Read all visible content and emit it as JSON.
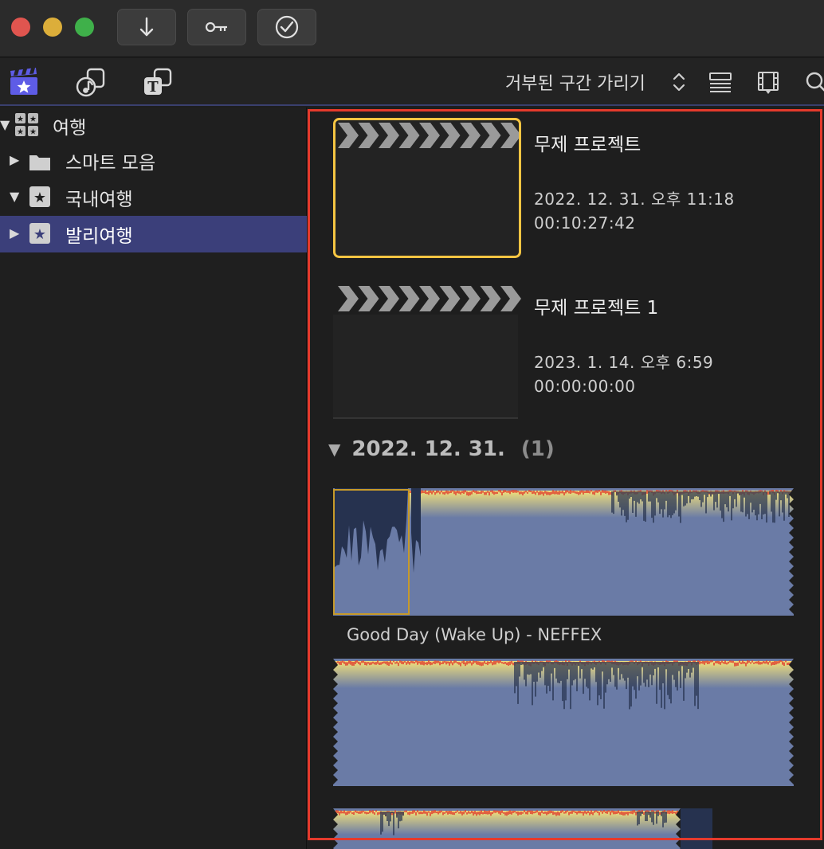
{
  "window": {
    "toolbar_buttons": [
      {
        "name": "import-button",
        "icon": "arrow-down-icon"
      },
      {
        "name": "keywords-button",
        "icon": "key-icon"
      },
      {
        "name": "background-tasks-button",
        "icon": "checkmark-circle-icon"
      }
    ]
  },
  "browser_toolbar": {
    "tabs": [
      {
        "name": "libraries-tab",
        "icon": "clapperboard-star-icon",
        "active": true
      },
      {
        "name": "photos-audio-tab",
        "icon": "music-photo-icon",
        "active": false
      },
      {
        "name": "titles-generators-tab",
        "icon": "titles-icon",
        "active": false
      }
    ],
    "filter_label": "거부된 구간 가리기",
    "right_icons": [
      "clip-appearance-icon",
      "filmstrip-icon",
      "search-icon"
    ]
  },
  "sidebar": {
    "library": {
      "label": "여행",
      "expanded": true
    },
    "items": [
      {
        "label": "스마트 모음",
        "icon": "folder-icon",
        "expanded": false,
        "selected": false
      },
      {
        "label": "국내여행",
        "icon": "event-star-icon",
        "expanded": true,
        "selected": false
      },
      {
        "label": "발리여행",
        "icon": "event-star-icon",
        "expanded": false,
        "selected": true
      }
    ]
  },
  "projects": [
    {
      "title": "무제 프로젝트",
      "date": "2022. 12. 31. 오후 11:18",
      "duration": "00:10:27:42",
      "selected": true
    },
    {
      "title": "무제 프로젝트 1",
      "date": "2023. 1. 14. 오후 6:59",
      "duration": "00:00:00:00",
      "selected": false
    }
  ],
  "date_group": {
    "date": "2022. 12. 31.",
    "count": "(1)"
  },
  "clips": [
    {
      "name": "Good Day (Wake Up) - NEFFEX"
    }
  ],
  "colors": {
    "accent_selection": "#3b3f7a",
    "selected_border": "#f5c542",
    "highlight_frame": "#e53a2c",
    "audio_clip": "#6a7ba6",
    "audio_peak": "#f2e07a"
  }
}
